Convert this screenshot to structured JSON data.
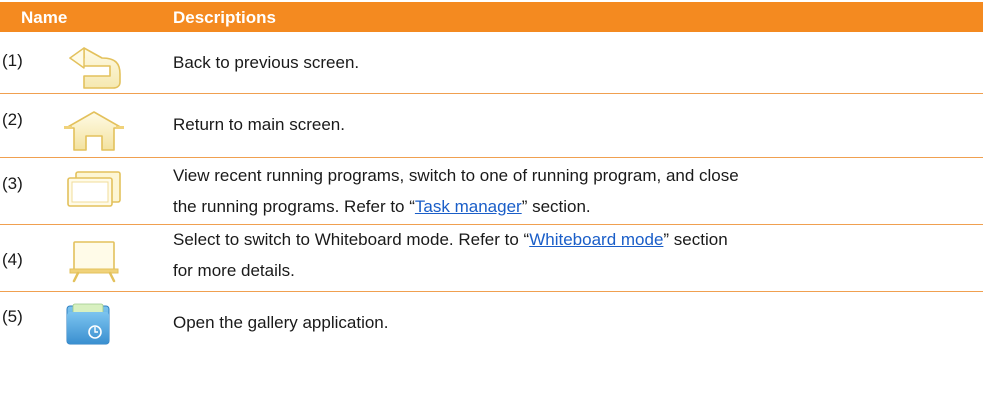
{
  "header": {
    "name": "Name",
    "descriptions": "Descriptions"
  },
  "rows": [
    {
      "number": "(1)",
      "icon": "back-arrow-icon",
      "text": "Back to previous screen."
    },
    {
      "number": "(2)",
      "icon": "home-icon",
      "text": "Return to main screen."
    },
    {
      "number": "(3)",
      "icon": "recent-apps-icon",
      "line1": "View recent running programs, switch to one of running program, and close",
      "line2_before": "the running programs. Refer to “",
      "link": "Task manager",
      "line2_after": "” section."
    },
    {
      "number": "(4)",
      "icon": "whiteboard-icon",
      "line1_before": "Select to switch to Whiteboard mode. Refer to “",
      "link": "Whiteboard mode",
      "line1_after": "” section",
      "line2": "for more details."
    },
    {
      "number": "(5)",
      "icon": "gallery-icon",
      "text": "Open the gallery application."
    }
  ],
  "colors": {
    "header_bg": "#f48a20",
    "row_border": "#f0a050",
    "link": "#1a5ec8",
    "icon_cream": "#fdf6d4",
    "icon_outline": "#e6c35a",
    "gallery_blue": "#4aa3de"
  }
}
